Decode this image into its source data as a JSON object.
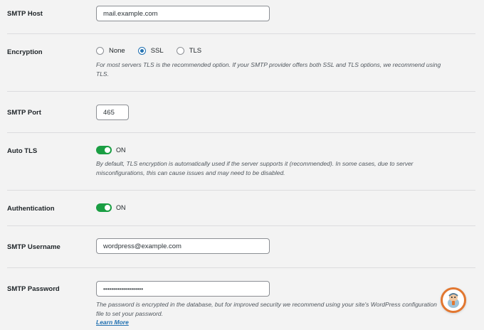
{
  "smtp_host": {
    "label": "SMTP Host",
    "value": "mail.example.com"
  },
  "encryption": {
    "label": "Encryption",
    "options": [
      {
        "label": "None",
        "checked": false
      },
      {
        "label": "SSL",
        "checked": true
      },
      {
        "label": "TLS",
        "checked": false
      }
    ],
    "description": "For most servers TLS is the recommended option. If your SMTP provider offers both SSL and TLS options, we recommend using TLS."
  },
  "smtp_port": {
    "label": "SMTP Port",
    "value": "465"
  },
  "auto_tls": {
    "label": "Auto TLS",
    "state": "ON",
    "description": "By default, TLS encryption is automatically used if the server supports it (recommended). In some cases, due to server misconfigurations, this can cause issues and may need to be disabled."
  },
  "authentication": {
    "label": "Authentication",
    "state": "ON"
  },
  "smtp_username": {
    "label": "SMTP Username",
    "value": "wordpress@example.com"
  },
  "smtp_password": {
    "label": "SMTP Password",
    "value": "••••••••••••••••••••",
    "description": "The password is encrypted in the database, but for improved security we recommend using your site's WordPress configuration file to set your password.",
    "learn_more": "Learn More"
  },
  "colors": {
    "accent": "#2271b1",
    "toggle_on": "#1a9e43",
    "help_border": "#e27730"
  },
  "help_icon": "mascot-help-icon"
}
